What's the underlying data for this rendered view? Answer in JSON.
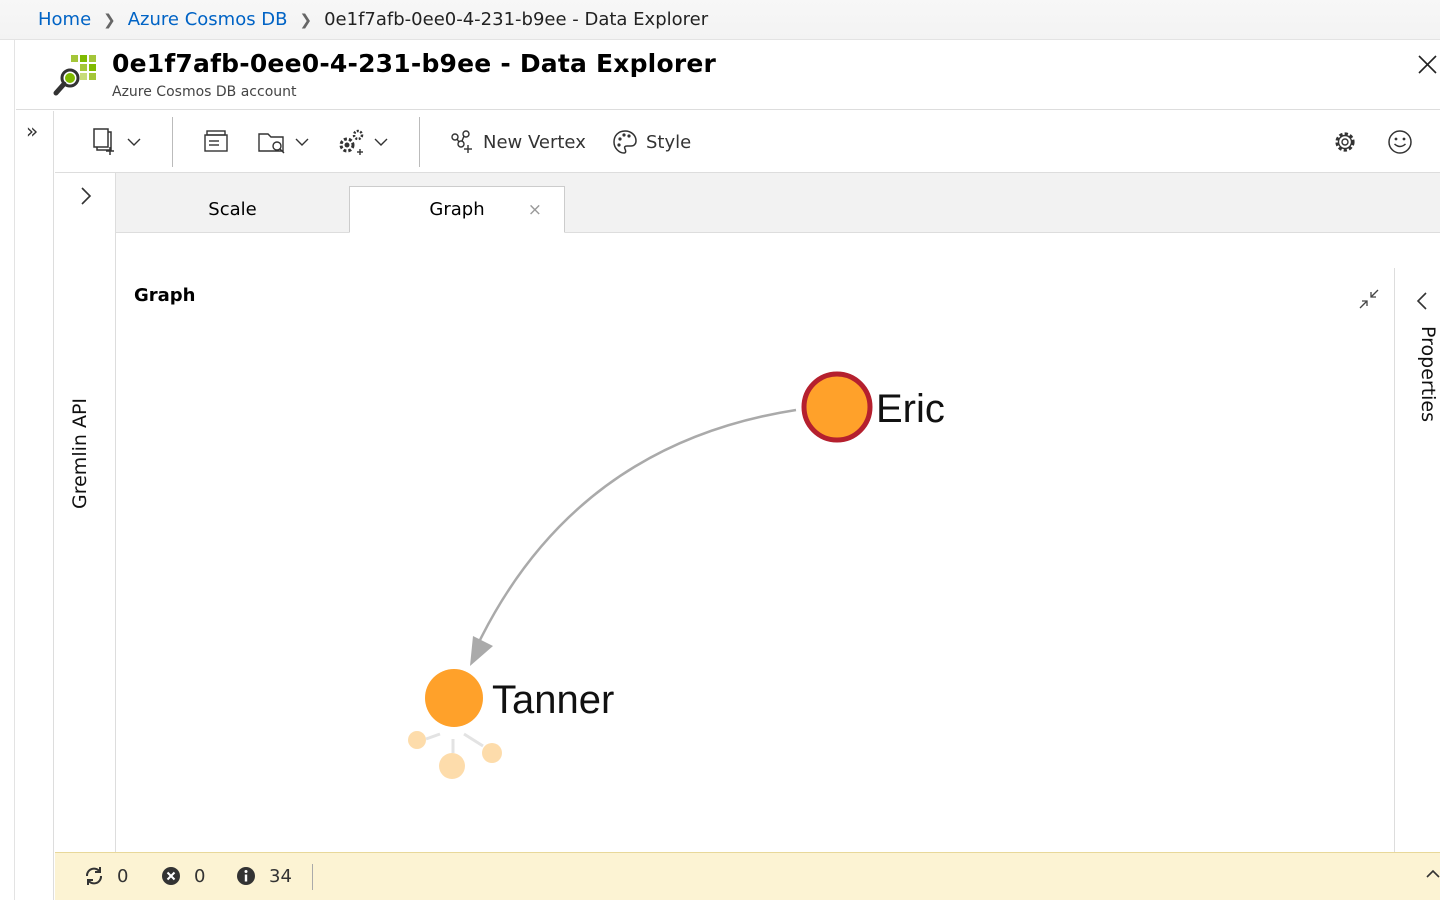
{
  "breadcrumb": {
    "home": "Home",
    "service": "Azure Cosmos DB",
    "current": "0e1f7afb-0ee0-4-231-b9ee - Data Explorer"
  },
  "resource": {
    "title": "0e1f7afb-0ee0-4-231-b9ee - Data Explorer",
    "subtitle": "Azure Cosmos DB account"
  },
  "toolbar": {
    "new_vertex": "New Vertex",
    "style": "Style"
  },
  "tree_panel": {
    "label": "Gremlin API"
  },
  "tabs": [
    {
      "label": "Scale",
      "active": false
    },
    {
      "label": "Graph",
      "active": true,
      "close": "×"
    }
  ],
  "graph": {
    "title": "Graph",
    "nodes": [
      {
        "label": "Eric",
        "selected": true,
        "color": "#ffa12a",
        "border": "#b5202e"
      },
      {
        "label": "Tanner",
        "selected": false,
        "color": "#ffa12a"
      }
    ],
    "edges": [
      {
        "from": "Eric",
        "to": "Tanner"
      }
    ]
  },
  "properties_panel": {
    "label": "Properties"
  },
  "status": {
    "in_progress": "0",
    "errors": "0",
    "info": "34"
  },
  "colors": {
    "link": "#0063c5",
    "node_fill": "#ffa12a",
    "node_selected_border": "#b5202e",
    "edge": "#aaaaaa",
    "status_bg": "#fcf3d3"
  }
}
